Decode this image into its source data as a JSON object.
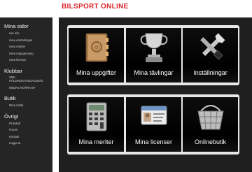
{
  "brand": {
    "title": "BILSPORT ONLINE"
  },
  "sidebar": {
    "sections": [
      {
        "title": "Mina sidor",
        "items": [
          "min info",
          "mina anmälningar",
          "mina meriter",
          "mina engagemang",
          "mina licenser"
        ]
      },
      {
        "title": "Klubbar",
        "items": [
          "SMK HÄLSINGKAVEDALEN/IG",
          "MEDKE NORRA BF"
        ]
      },
      {
        "title": "Butik",
        "items": [
          "Mina inköp"
        ]
      },
      {
        "title": "Övrigt",
        "items": [
          "Protokoll",
          "Forum",
          "Kontakt",
          "Logga ut"
        ]
      }
    ]
  },
  "tiles": [
    {
      "label": "Mina uppgifter",
      "icon": "address-book-icon"
    },
    {
      "label": "Mina tävlingar",
      "icon": "trophy-icon"
    },
    {
      "label": "Inställningar",
      "icon": "tools-icon"
    },
    {
      "label": "Mina meriter",
      "icon": "calculator-icon"
    },
    {
      "label": "Mina licenser",
      "icon": "id-card-icon"
    },
    {
      "label": "Onlinebutik",
      "icon": "shopping-basket-icon"
    }
  ]
}
